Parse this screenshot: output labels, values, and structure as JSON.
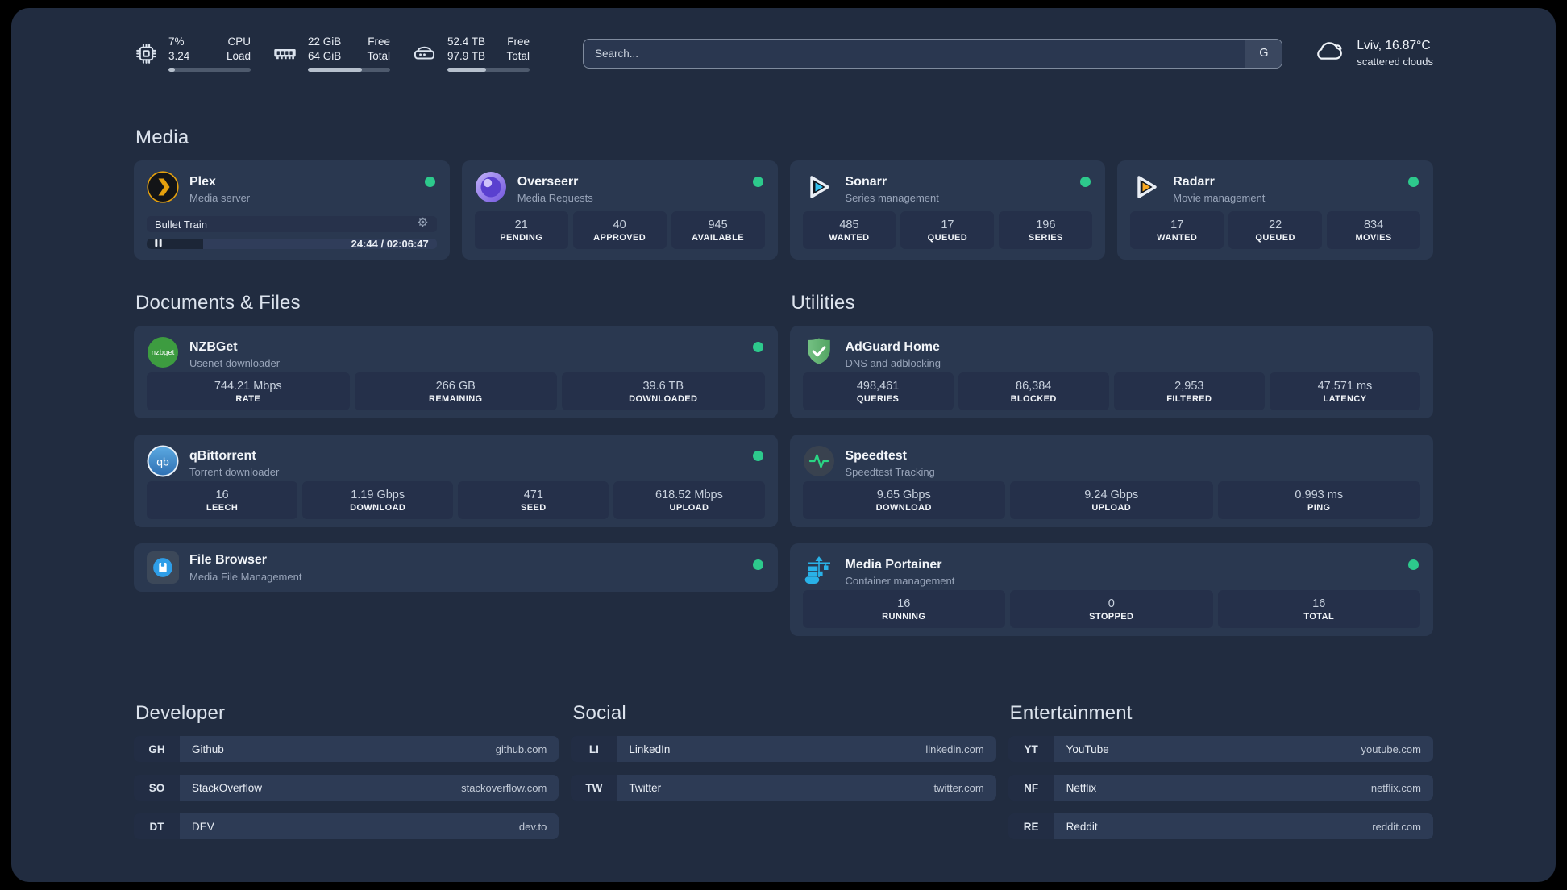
{
  "colors": {
    "online": "#2dc98c",
    "plex_orange": "#e5a00d",
    "sonarr_blue": "#33c1f0",
    "radarr_yellow": "#f7a823",
    "nzbget_green": "#3d9c40",
    "adguard_green": "#5fae6e",
    "portainer_blue": "#29b2e8"
  },
  "header": {
    "metrics": [
      {
        "name": "cpu",
        "val_top": "7%",
        "val_bottom": "3.24",
        "label_top": "CPU",
        "label_bottom": "Load",
        "progress": "8%"
      },
      {
        "name": "ram",
        "val_top": "22 GiB",
        "val_bottom": "64 GiB",
        "label_top": "Free",
        "label_bottom": "Total",
        "progress": "66%"
      },
      {
        "name": "disk",
        "val_top": "52.4 TB",
        "val_bottom": "97.9 TB",
        "label_top": "Free",
        "label_bottom": "Total",
        "progress": "47%"
      }
    ],
    "search": {
      "placeholder": "Search...",
      "engine_button": "G"
    },
    "weather": {
      "location_temp": "Lviv, 16.87°C",
      "condition": "scattered clouds"
    }
  },
  "media": {
    "title": "Media",
    "plex": {
      "name": "Plex",
      "desc": "Media server",
      "player": {
        "title": "Bullet Train",
        "time": "24:44 / 02:06:47",
        "progress": "19.5%"
      }
    },
    "overseerr": {
      "name": "Overseerr",
      "desc": "Media Requests",
      "stats": [
        {
          "value": "21",
          "label": "PENDING"
        },
        {
          "value": "40",
          "label": "APPROVED"
        },
        {
          "value": "945",
          "label": "AVAILABLE"
        }
      ]
    },
    "sonarr": {
      "name": "Sonarr",
      "desc": "Series management",
      "stats": [
        {
          "value": "485",
          "label": "WANTED"
        },
        {
          "value": "17",
          "label": "QUEUED"
        },
        {
          "value": "196",
          "label": "SERIES"
        }
      ]
    },
    "radarr": {
      "name": "Radarr",
      "desc": "Movie management",
      "stats": [
        {
          "value": "17",
          "label": "WANTED"
        },
        {
          "value": "22",
          "label": "QUEUED"
        },
        {
          "value": "834",
          "label": "MOVIES"
        }
      ]
    }
  },
  "documents": {
    "title": "Documents & Files",
    "nzbget": {
      "name": "NZBGet",
      "desc": "Usenet downloader",
      "stats": [
        {
          "value": "744.21 Mbps",
          "label": "RATE"
        },
        {
          "value": "266 GB",
          "label": "REMAINING"
        },
        {
          "value": "39.6 TB",
          "label": "DOWNLOADED"
        }
      ]
    },
    "qbittorrent": {
      "name": "qBittorrent",
      "desc": "Torrent downloader",
      "stats": [
        {
          "value": "16",
          "label": "LEECH"
        },
        {
          "value": "1.19 Gbps",
          "label": "DOWNLOAD"
        },
        {
          "value": "471",
          "label": "SEED"
        },
        {
          "value": "618.52 Mbps",
          "label": "UPLOAD"
        }
      ]
    },
    "filebrowser": {
      "name": "File Browser",
      "desc": "Media File Management"
    }
  },
  "utilities": {
    "title": "Utilities",
    "adguard": {
      "name": "AdGuard Home",
      "desc": "DNS and adblocking",
      "stats": [
        {
          "value": "498,461",
          "label": "QUERIES"
        },
        {
          "value": "86,384",
          "label": "BLOCKED"
        },
        {
          "value": "2,953",
          "label": "FILTERED"
        },
        {
          "value": "47.571 ms",
          "label": "LATENCY"
        }
      ]
    },
    "speedtest": {
      "name": "Speedtest",
      "desc": "Speedtest Tracking",
      "stats": [
        {
          "value": "9.65 Gbps",
          "label": "DOWNLOAD"
        },
        {
          "value": "9.24 Gbps",
          "label": "UPLOAD"
        },
        {
          "value": "0.993 ms",
          "label": "PING"
        }
      ]
    },
    "portainer": {
      "name": "Media Portainer",
      "desc": "Container management",
      "stats": [
        {
          "value": "16",
          "label": "RUNNING"
        },
        {
          "value": "0",
          "label": "STOPPED"
        },
        {
          "value": "16",
          "label": "TOTAL"
        }
      ]
    }
  },
  "links": {
    "developer": {
      "title": "Developer",
      "items": [
        {
          "abbr": "GH",
          "name": "Github",
          "url": "github.com"
        },
        {
          "abbr": "SO",
          "name": "StackOverflow",
          "url": "stackoverflow.com"
        },
        {
          "abbr": "DT",
          "name": "DEV",
          "url": "dev.to"
        }
      ]
    },
    "social": {
      "title": "Social",
      "items": [
        {
          "abbr": "LI",
          "name": "LinkedIn",
          "url": "linkedin.com"
        },
        {
          "abbr": "TW",
          "name": "Twitter",
          "url": "twitter.com"
        }
      ]
    },
    "entertainment": {
      "title": "Entertainment",
      "items": [
        {
          "abbr": "YT",
          "name": "YouTube",
          "url": "youtube.com"
        },
        {
          "abbr": "NF",
          "name": "Netflix",
          "url": "netflix.com"
        },
        {
          "abbr": "RE",
          "name": "Reddit",
          "url": "reddit.com"
        }
      ]
    }
  }
}
